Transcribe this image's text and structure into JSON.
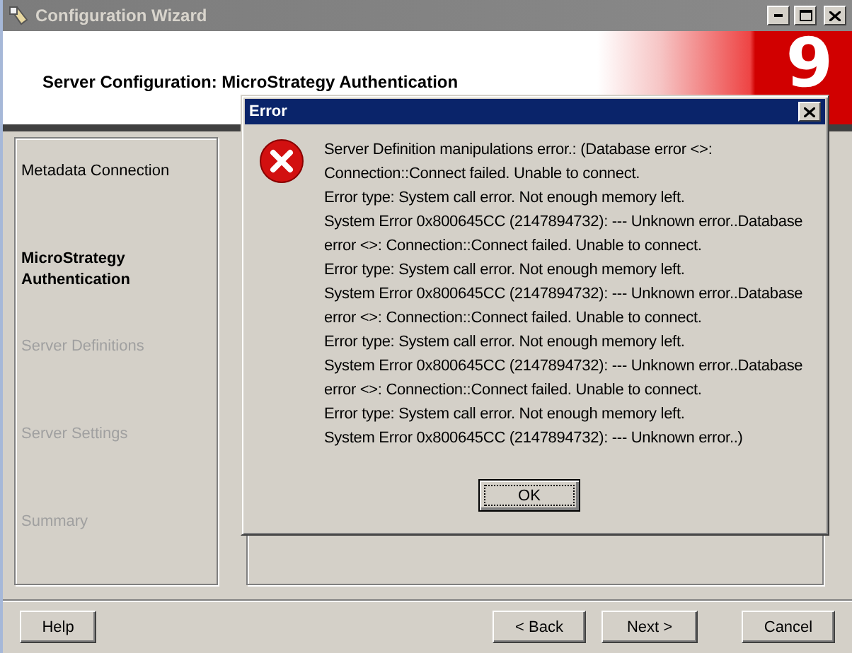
{
  "window": {
    "title": "Configuration Wizard"
  },
  "header": {
    "title": "Server Configuration: MicroStrategy Authentication",
    "logo_mark": "9"
  },
  "steps": [
    {
      "label": "Metadata Connection",
      "selected": false,
      "disabled": false
    },
    {
      "label": "MicroStrategy Authentication",
      "selected": true,
      "disabled": false
    },
    {
      "label": "Server Definitions",
      "selected": false,
      "disabled": true
    },
    {
      "label": "Server Settings",
      "selected": false,
      "disabled": true
    },
    {
      "label": "Summary",
      "selected": false,
      "disabled": true
    }
  ],
  "buttons": [
    {
      "label": "Help",
      "kind": "help"
    },
    {
      "label": "< Back",
      "kind": "back"
    },
    {
      "label": "Next >",
      "kind": "next"
    },
    {
      "label": "Cancel",
      "kind": "cancel"
    }
  ],
  "dialog": {
    "title": "Error",
    "message": "Server Definition manipulations error.: (Database error <>:\nConnection::Connect failed. Unable to connect.\nError type: System call error. Not enough memory left.\nSystem Error 0x800645CC (2147894732): --- Unknown error..Database\nerror <>: Connection::Connect failed. Unable to connect.\nError type: System call error. Not enough memory left.\nSystem Error 0x800645CC (2147894732): --- Unknown error..Database\nerror <>: Connection::Connect failed. Unable to connect.\nError type: System call error. Not enough memory left.\nSystem Error 0x800645CC (2147894732): --- Unknown error..Database\nerror <>: Connection::Connect failed. Unable to connect.\nError type: System call error. Not enough memory left.\nSystem Error 0x800645CC (2147894732): --- Unknown error..)",
    "button": "OK"
  }
}
